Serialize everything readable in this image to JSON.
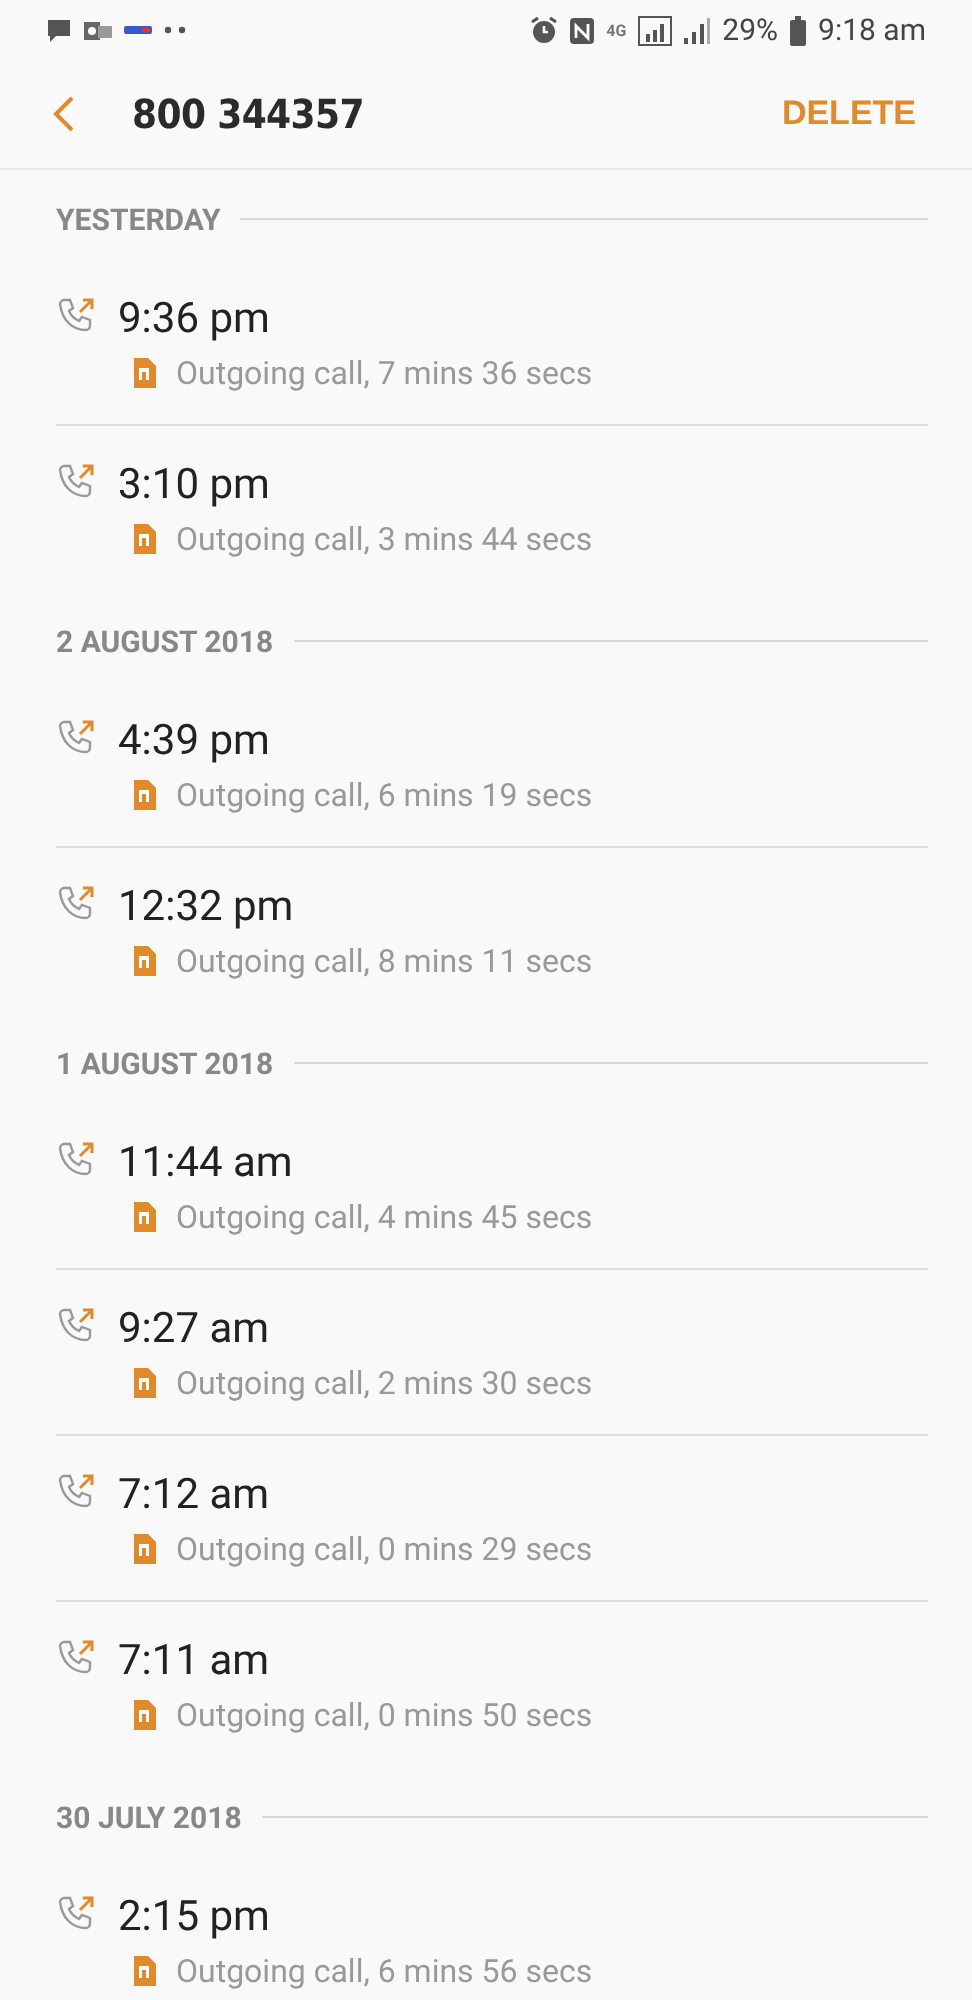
{
  "status_bar": {
    "network": "4G",
    "battery": "29%",
    "time": "9:18 am"
  },
  "header": {
    "title": "800 344357",
    "action": "DELETE"
  },
  "sections": [
    {
      "date": "YESTERDAY",
      "calls": [
        {
          "time": "9:36 pm",
          "detail": "Outgoing call, 7 mins 36 secs"
        },
        {
          "time": "3:10 pm",
          "detail": "Outgoing call, 3 mins 44 secs"
        }
      ]
    },
    {
      "date": "2 AUGUST 2018",
      "calls": [
        {
          "time": "4:39 pm",
          "detail": "Outgoing call, 6 mins 19 secs"
        },
        {
          "time": "12:32 pm",
          "detail": "Outgoing call, 8 mins 11 secs"
        }
      ]
    },
    {
      "date": "1 AUGUST 2018",
      "calls": [
        {
          "time": "11:44 am",
          "detail": "Outgoing call, 4 mins 45 secs"
        },
        {
          "time": "9:27 am",
          "detail": "Outgoing call, 2 mins 30 secs"
        },
        {
          "time": "7:12 am",
          "detail": "Outgoing call, 0 mins 29 secs"
        },
        {
          "time": "7:11 am",
          "detail": "Outgoing call, 0 mins 50 secs"
        }
      ]
    },
    {
      "date": "30 JULY 2018",
      "calls": [
        {
          "time": "2:15 pm",
          "detail": "Outgoing call, 6 mins 56 secs"
        }
      ]
    }
  ]
}
